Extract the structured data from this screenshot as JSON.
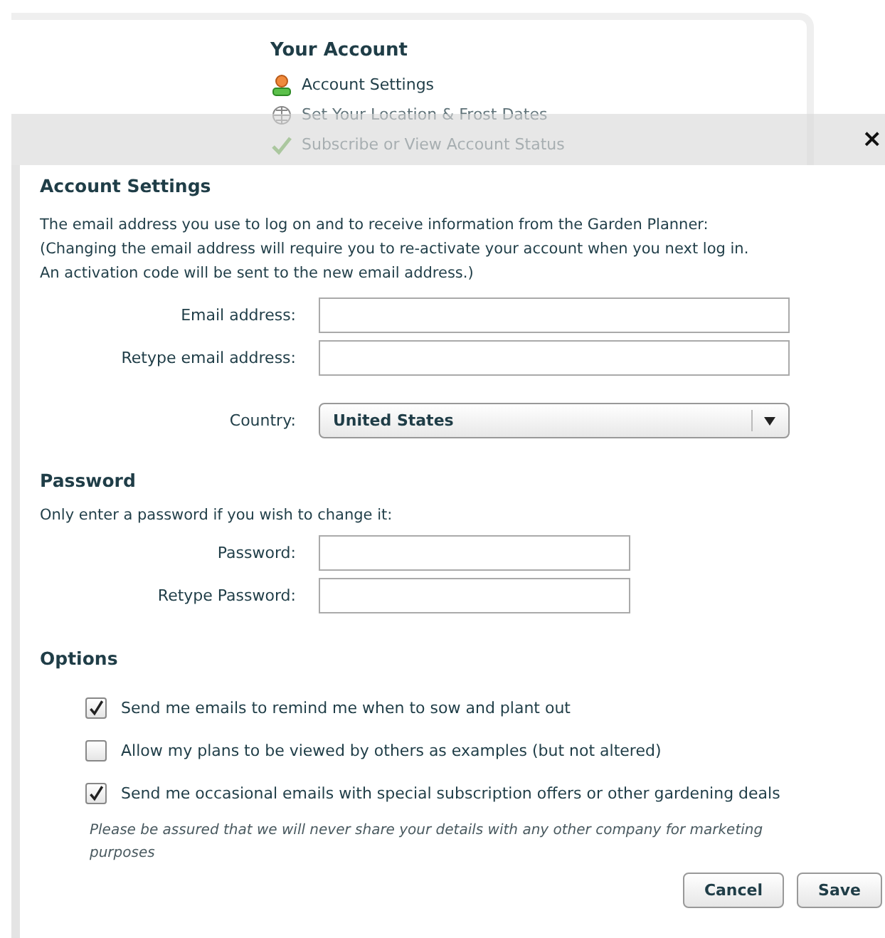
{
  "background_page": {
    "heading": "Your Account",
    "links": [
      {
        "label": "Account Settings"
      },
      {
        "label": "Set Your Location & Frost Dates"
      },
      {
        "label": "Subscribe or View Account Status"
      }
    ]
  },
  "dialog": {
    "close": "×",
    "title": "Account Settings",
    "intro": [
      "The email address you use to log on and to receive information from the Garden Planner:",
      "(Changing the email address will require you to re-activate your account when you next log in.",
      "An activation code will be sent to the new email address.)"
    ],
    "account_fields": [
      {
        "label": "Email address:",
        "kind": "text"
      },
      {
        "label": "Retype email address:",
        "kind": "text"
      },
      {
        "label": "Country:",
        "kind": "select",
        "value": "United States"
      }
    ],
    "password_title": "Password",
    "password_hint": "Only enter a password if you wish to change it:",
    "password_fields": [
      {
        "label": "Password:"
      },
      {
        "label": "Retype Password:"
      }
    ],
    "options_title": "Options",
    "options": [
      {
        "label": "Send me emails to remind me when to sow and plant out",
        "checked": true
      },
      {
        "label": "Allow my plans to be viewed by others as examples (but not altered)",
        "checked": false
      },
      {
        "label": "Send me occasional emails with special subscription offers or other gardening deals",
        "checked": true
      }
    ],
    "privacy_note": "Please be assured that we will never share your details with any other company for marketing purposes",
    "buttons": [
      "Cancel",
      "Save"
    ]
  }
}
